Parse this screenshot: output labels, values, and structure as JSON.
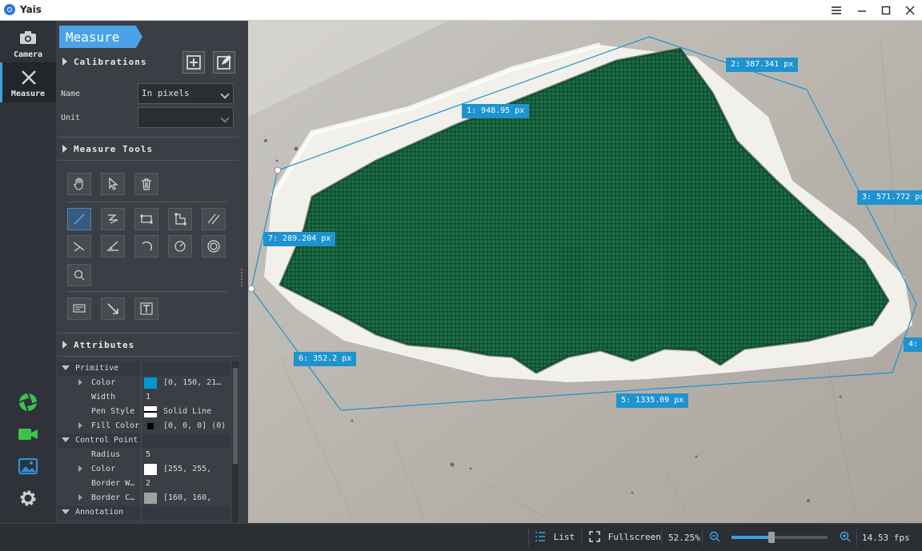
{
  "app": {
    "title": "Yais"
  },
  "rail": {
    "camera_label": "Camera",
    "measure_label": "Measure"
  },
  "panel": {
    "header": "Measure",
    "calibrations": {
      "title": "Calibrations",
      "name_label": "Name",
      "name_value": "In pixels",
      "unit_label": "Unit",
      "unit_value": ""
    },
    "measure_tools_title": "Measure Tools",
    "attributes_title": "Attributes",
    "attributes": {
      "primitive": "Primitive",
      "color_key": "Color",
      "color_value": "[0, 150, 21…",
      "color_hex": "#0096d7",
      "width_key": "Width",
      "width_value": "1",
      "pen_style_key": "Pen Style",
      "pen_style_value": "Solid Line",
      "fill_color_key": "Fill Color",
      "fill_color_value": "[0, 0, 0] (0)",
      "control_point": "Control Point",
      "radius_key": "Radius",
      "radius_value": "5",
      "cp_color_key": "Color",
      "cp_color_value": "[255, 255,",
      "border_width_key": "Border W…",
      "border_width_value": "2",
      "border_color_key": "Border C…",
      "border_color_value": "[160, 160,",
      "annotation": "Annotation"
    }
  },
  "viewer": {
    "accent_color": "#1f93cf",
    "measurements": [
      {
        "id": "1",
        "text": "1: 948.95 px"
      },
      {
        "id": "2",
        "text": "2: 387.341 px"
      },
      {
        "id": "3",
        "text": "3: 571.772 px"
      },
      {
        "id": "4",
        "text": "4:"
      },
      {
        "id": "5",
        "text": "5: 1335.09 px"
      },
      {
        "id": "6",
        "text": "6: 352.2 px"
      },
      {
        "id": "7",
        "text": "7: 289.204 px"
      }
    ]
  },
  "status": {
    "list_label": "List",
    "fullscreen_label": "Fullscreen",
    "zoom_value": "52.25%",
    "zoom_fraction": 0.42,
    "fps": "14.53 fps"
  }
}
